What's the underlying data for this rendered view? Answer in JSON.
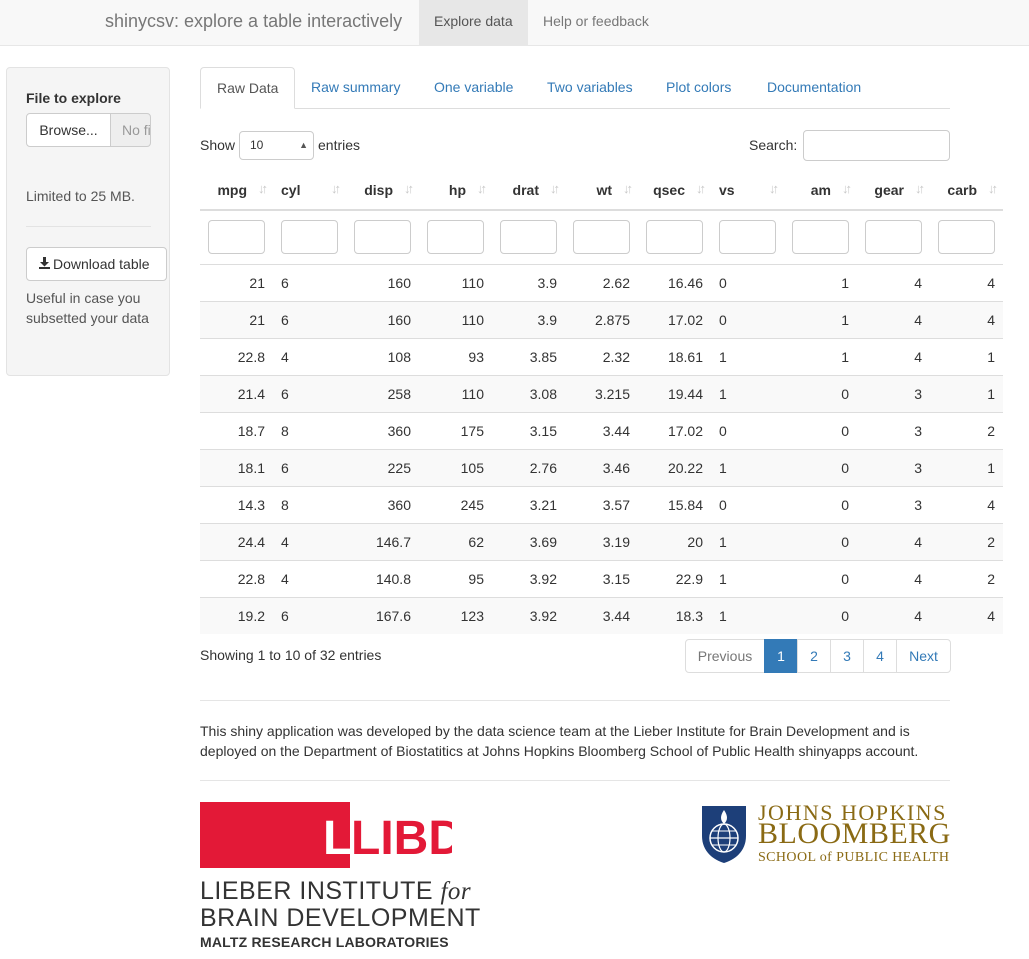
{
  "navbar": {
    "brand": "shinycsv: explore a table interactively",
    "tabs": [
      "Explore data",
      "Help or feedback"
    ]
  },
  "sidebar": {
    "file_label": "File to explore",
    "browse_label": "Browse...",
    "file_placeholder": "No file selected",
    "limit_text": "Limited to 25 MB.",
    "download_label": "Download table",
    "download_help": "Useful in case you subsetted your data"
  },
  "tabs": [
    "Raw Data",
    "Raw summary",
    "One variable",
    "Two variables",
    "Plot colors",
    "Documentation"
  ],
  "table_controls": {
    "show_label": "Show",
    "page_length": "10",
    "entries_label": "entries",
    "search_label": "Search:",
    "search_value": ""
  },
  "table": {
    "columns": [
      "mpg",
      "cyl",
      "disp",
      "hp",
      "drat",
      "wt",
      "qsec",
      "vs",
      "am",
      "gear",
      "carb"
    ],
    "rows": [
      [
        "21",
        "6",
        "160",
        "110",
        "3.9",
        "2.62",
        "16.46",
        "0",
        "1",
        "4",
        "4"
      ],
      [
        "21",
        "6",
        "160",
        "110",
        "3.9",
        "2.875",
        "17.02",
        "0",
        "1",
        "4",
        "4"
      ],
      [
        "22.8",
        "4",
        "108",
        "93",
        "3.85",
        "2.32",
        "18.61",
        "1",
        "1",
        "4",
        "1"
      ],
      [
        "21.4",
        "6",
        "258",
        "110",
        "3.08",
        "3.215",
        "19.44",
        "1",
        "0",
        "3",
        "1"
      ],
      [
        "18.7",
        "8",
        "360",
        "175",
        "3.15",
        "3.44",
        "17.02",
        "0",
        "0",
        "3",
        "2"
      ],
      [
        "18.1",
        "6",
        "225",
        "105",
        "2.76",
        "3.46",
        "20.22",
        "1",
        "0",
        "3",
        "1"
      ],
      [
        "14.3",
        "8",
        "360",
        "245",
        "3.21",
        "3.57",
        "15.84",
        "0",
        "0",
        "3",
        "4"
      ],
      [
        "24.4",
        "4",
        "146.7",
        "62",
        "3.69",
        "3.19",
        "20",
        "1",
        "0",
        "4",
        "2"
      ],
      [
        "22.8",
        "4",
        "140.8",
        "95",
        "3.92",
        "3.15",
        "22.9",
        "1",
        "0",
        "4",
        "2"
      ],
      [
        "19.2",
        "6",
        "167.6",
        "123",
        "3.92",
        "3.44",
        "18.3",
        "1",
        "0",
        "4",
        "4"
      ]
    ]
  },
  "table_info": "Showing 1 to 10 of 32 entries",
  "pagination": {
    "previous": "Previous",
    "pages": [
      "1",
      "2",
      "3",
      "4"
    ],
    "next": "Next"
  },
  "footer": {
    "text": "This shiny application was developed by the data science team at the Lieber Institute for Brain Development and is deployed on the Department of Biostatitics at Johns Hopkins Bloomberg School of Public Health shinyapps account."
  },
  "logos": {
    "libd": {
      "mark": "LIBD",
      "line1_a": "LIEBER INSTITUTE ",
      "line1_b": "for",
      "line2": "BRAIN DEVELOPMENT",
      "line3": "MALTZ RESEARCH LABORATORIES",
      "color": "#e31937"
    },
    "jhu": {
      "line1": "JOHNS HOPKINS",
      "line2": "BLOOMBERG",
      "line3": "SCHOOL of PUBLIC HEALTH",
      "color": "#8a6a14",
      "seal_color": "#1d3f79"
    }
  },
  "colors": {
    "link": "#337ab7",
    "active_page": "#337ab7"
  }
}
